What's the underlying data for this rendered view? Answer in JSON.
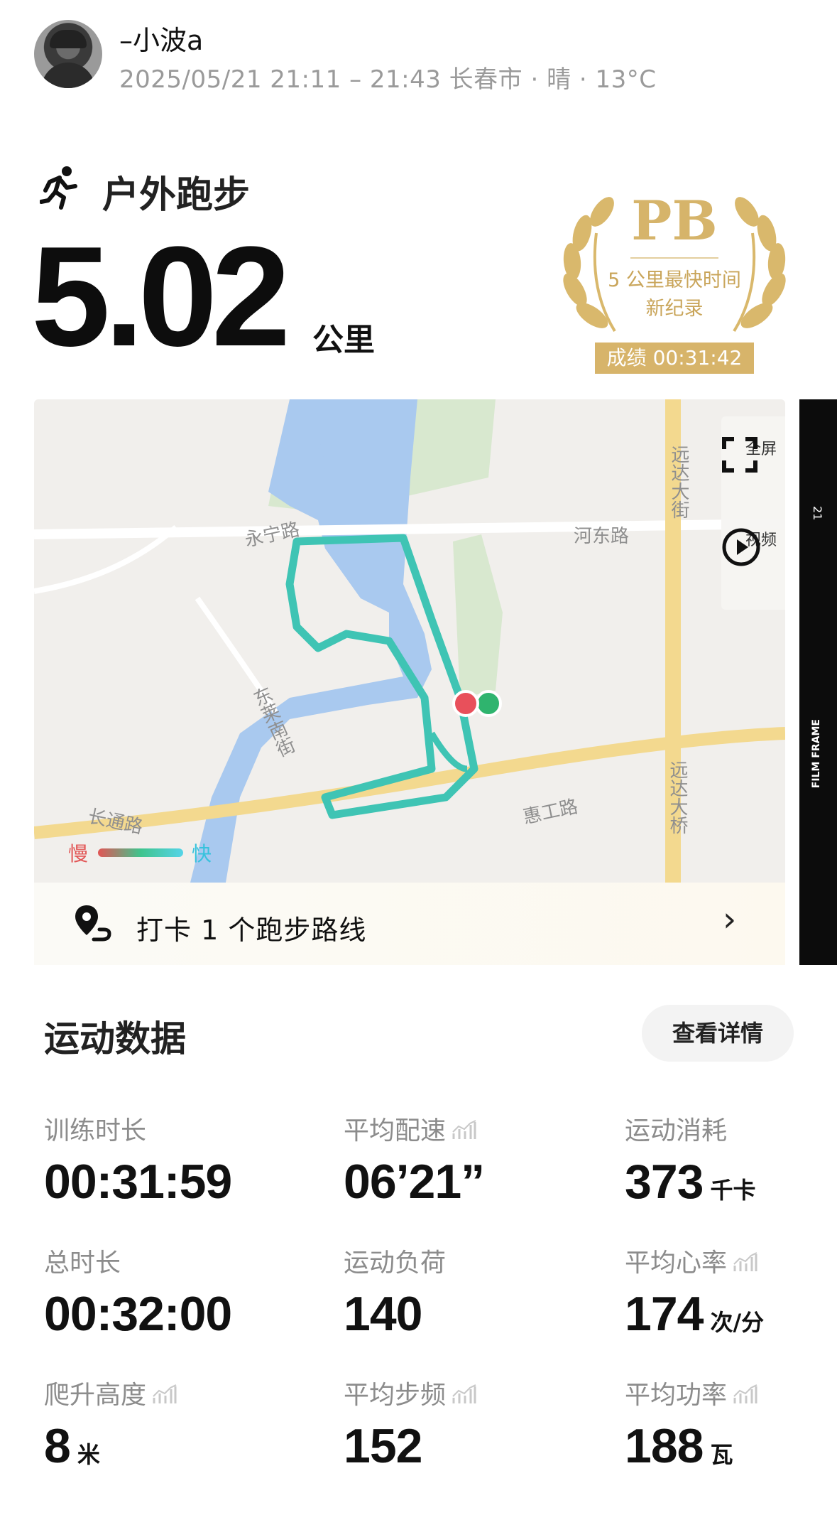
{
  "header": {
    "username": "–小波a",
    "meta": "2025/05/21 21:11 – 21:43 长春市 · 晴 · 13°C"
  },
  "activity": {
    "type_label": "户外跑步",
    "distance": "5.02",
    "distance_unit": "公里"
  },
  "pb_badge": {
    "title": "PB",
    "line1": "5 公里最快时间",
    "line2": "新纪录",
    "score": "成绩 00:31:42",
    "color": "#d6b46a"
  },
  "map": {
    "controls": {
      "fullscreen": "全屏",
      "video": "视频"
    },
    "legend": {
      "slow": "慢",
      "fast": "快"
    },
    "roads": [
      "永宁路",
      "河东路",
      "远达大街",
      "东莱南街",
      "长通路",
      "惠工路",
      "远达大桥"
    ],
    "colors": {
      "water": "#a9c9ef",
      "park": "#d8e8cf",
      "road": "#f3d98f",
      "route": "#3fc4b4",
      "start": "#2fb46e",
      "end": "#e8505b"
    }
  },
  "checkin": {
    "label": "打卡 1 个跑步路线"
  },
  "film": {
    "top": "21",
    "label": "FILM FRAME"
  },
  "stats": {
    "title": "运动数据",
    "detail_button": "查看详情",
    "items": [
      {
        "label": "训练时长",
        "value": "00:31:59",
        "unit": "",
        "chart": false
      },
      {
        "label": "平均配速",
        "value": "06’21”",
        "unit": "",
        "chart": true
      },
      {
        "label": "运动消耗",
        "value": "373",
        "unit": "千卡",
        "chart": false
      },
      {
        "label": "总时长",
        "value": "00:32:00",
        "unit": "",
        "chart": false
      },
      {
        "label": "运动负荷",
        "value": "140",
        "unit": "",
        "chart": false
      },
      {
        "label": "平均心率",
        "value": "174",
        "unit": "次/分",
        "chart": true
      },
      {
        "label": "爬升高度",
        "value": "8",
        "unit": "米",
        "chart": true
      },
      {
        "label": "平均步频",
        "value": "152",
        "unit": "",
        "chart": true
      },
      {
        "label": "平均功率",
        "value": "188",
        "unit": "瓦",
        "chart": true
      }
    ]
  }
}
